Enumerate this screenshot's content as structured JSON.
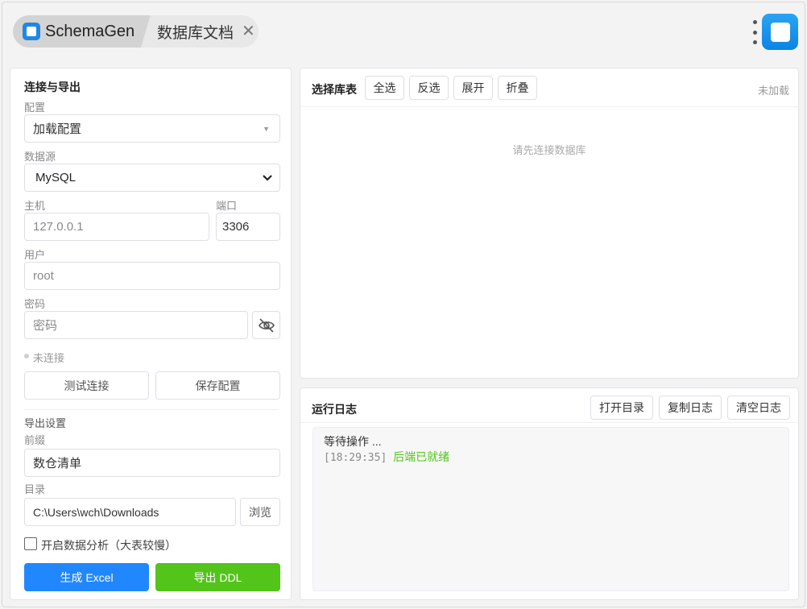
{
  "tabs": {
    "app_name": "SchemaGen",
    "doc_tab": "数据库文档",
    "close_glyph": "✕"
  },
  "left_panel": {
    "title": "连接与导出",
    "config_label": "配置",
    "config_value": "加载配置",
    "datasource_label": "数据源",
    "datasource_value": "MySQL",
    "host_label": "主机",
    "host_placeholder": "127.0.0.1",
    "port_label": "端口",
    "port_value": "3306",
    "user_label": "用户",
    "user_placeholder": "root",
    "password_label": "密码",
    "password_placeholder": "密码",
    "status_text": "未连接",
    "test_button": "测试连接",
    "save_button": "保存配置",
    "export_title": "导出设置",
    "prefix_label": "前缀",
    "prefix_value": "数仓清单",
    "dir_label": "目录",
    "dir_value": "C:\\Users\\wch\\Downloads",
    "browse_button": "浏览",
    "analysis_checkbox_label": "开启数据分析（大表较慢）",
    "analysis_checked": false,
    "excel_button": "生成 Excel",
    "ddl_button": "导出 DDL"
  },
  "tables_panel": {
    "title": "选择库表",
    "select_all": "全选",
    "invert": "反选",
    "expand": "展开",
    "collapse": "折叠",
    "status": "未加载",
    "empty_text": "请先连接数据库"
  },
  "logs_panel": {
    "title": "运行日志",
    "open_dir": "打开目录",
    "copy_log": "复制日志",
    "clear_log": "清空日志",
    "lines": {
      "waiting": "等待操作 ...",
      "time": "[18:29:35]",
      "ready": "后端已就绪"
    }
  },
  "colors": {
    "primary": "#2187ff",
    "success": "#52c41a",
    "brand": "#1e88e5"
  }
}
